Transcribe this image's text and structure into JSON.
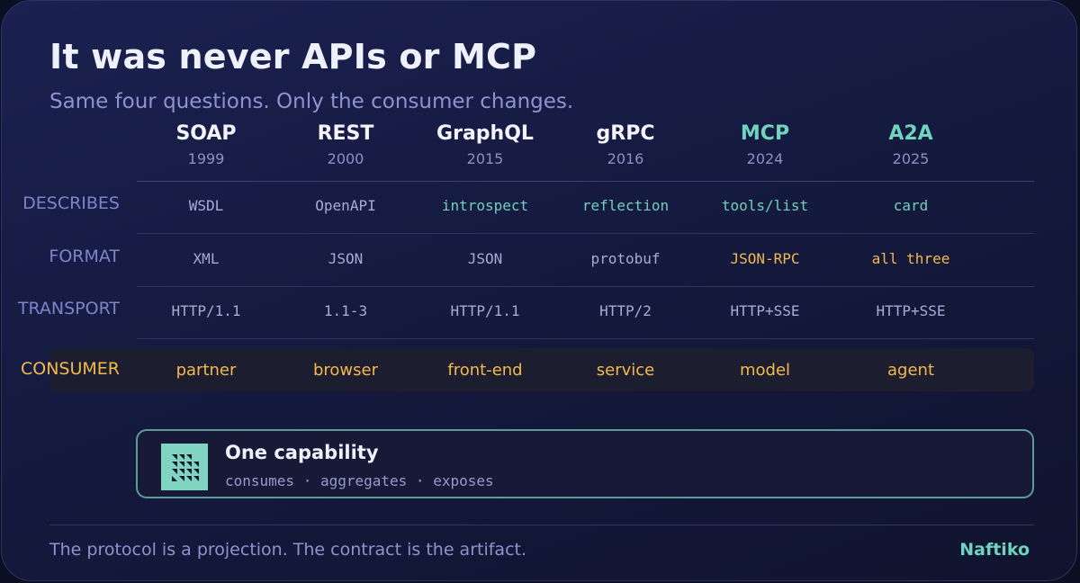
{
  "title": "It was never APIs or MCP",
  "subtitle": "Same four questions. Only the consumer changes.",
  "columns": [
    {
      "name": "SOAP",
      "year": "1999",
      "accent": false
    },
    {
      "name": "REST",
      "year": "2000",
      "accent": false
    },
    {
      "name": "GraphQL",
      "year": "2015",
      "accent": false
    },
    {
      "name": "gRPC",
      "year": "2016",
      "accent": false
    },
    {
      "name": "MCP",
      "year": "2024",
      "accent": true
    },
    {
      "name": "A2A",
      "year": "2025",
      "accent": true
    }
  ],
  "rows": [
    {
      "label": "DESCRIBES",
      "cells": [
        "WSDL",
        "OpenAPI",
        "introspect",
        "reflection",
        "tools/list",
        "card"
      ]
    },
    {
      "label": "FORMAT",
      "cells": [
        "XML",
        "JSON",
        "JSON",
        "protobuf",
        "JSON-RPC",
        "all three"
      ]
    },
    {
      "label": "TRANSPORT",
      "cells": [
        "HTTP/1.1",
        "1.1-3",
        "HTTP/1.1",
        "HTTP/2",
        "HTTP+SSE",
        "HTTP+SSE"
      ]
    }
  ],
  "consumer": {
    "label": "CONSUMER",
    "cells": [
      "partner",
      "browser",
      "front-end",
      "service",
      "model",
      "agent"
    ]
  },
  "capability": {
    "title": "One capability",
    "subtitle": "consumes · aggregates · exposes",
    "icon": "naftiko-logo-icon"
  },
  "footer": {
    "text": "The protocol is a projection. The contract is the artifact.",
    "brand": "Naftiko"
  },
  "colors": {
    "teal": "#6fd3bd",
    "amber": "#f3b94c",
    "background": "#151a40"
  }
}
